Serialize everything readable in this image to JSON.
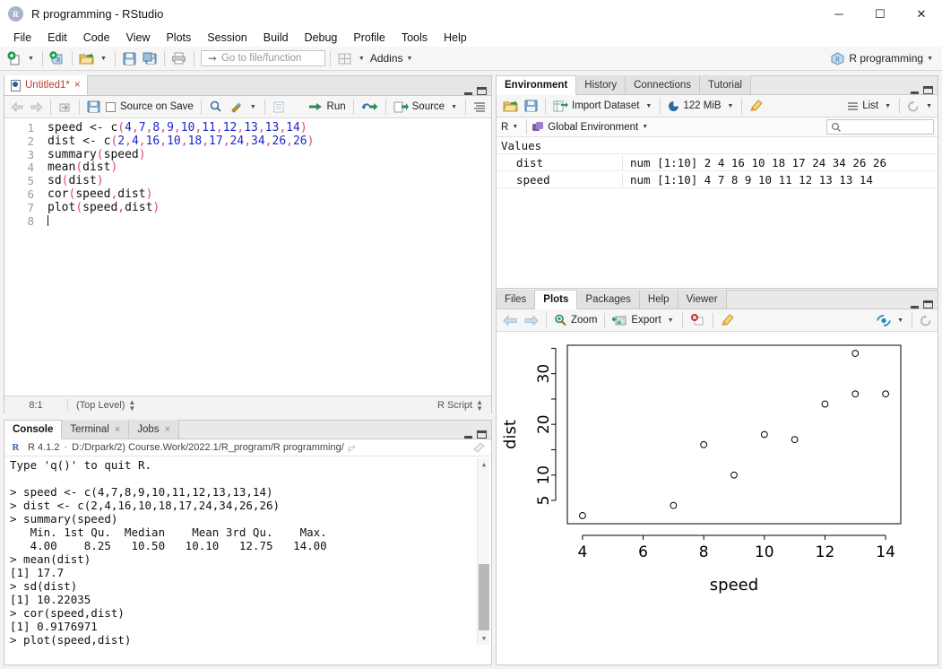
{
  "window": {
    "title": "R programming - RStudio",
    "app_icon": "R",
    "minimize": "─",
    "maximize": "☐",
    "close": "✕"
  },
  "menubar": {
    "items": [
      "File",
      "Edit",
      "Code",
      "View",
      "Plots",
      "Session",
      "Build",
      "Debug",
      "Profile",
      "Tools",
      "Help"
    ]
  },
  "toolbar": {
    "goto_placeholder": "Go to file/function",
    "addins_label": "Addins",
    "project_label": "R programming"
  },
  "source": {
    "tab_label": "Untitled1*",
    "tab_close": "×",
    "toolbar": {
      "source_on_save": "Source on Save",
      "run_label": "Run",
      "source_label": "Source"
    },
    "line_numbers": [
      "1",
      "2",
      "3",
      "4",
      "5",
      "6",
      "7",
      "8"
    ],
    "code": [
      {
        "name": "speed",
        "op": " <- ",
        "fn": "c",
        "args": "4,7,8,9,10,11,12,13,13,14"
      },
      {
        "name": "dist",
        "op": " <- ",
        "fn": "c",
        "args": "2,4,16,10,18,17,24,34,26,26"
      },
      {
        "name": "",
        "op": "",
        "fn": "summary",
        "args": "speed"
      },
      {
        "name": "",
        "op": "",
        "fn": "mean",
        "args": "dist"
      },
      {
        "name": "",
        "op": "",
        "fn": "sd",
        "args": "dist"
      },
      {
        "name": "",
        "op": "",
        "fn": "cor",
        "args": "speed,dist"
      },
      {
        "name": "",
        "op": "",
        "fn": "plot",
        "args": "speed,dist"
      }
    ],
    "status": {
      "position": "8:1",
      "scope": "(Top Level)",
      "file_type": "R Script"
    }
  },
  "console": {
    "tabs": [
      {
        "label": "Console",
        "closable": false,
        "active": true
      },
      {
        "label": "Terminal",
        "closable": true,
        "active": false
      },
      {
        "label": "Jobs",
        "closable": true,
        "active": false
      }
    ],
    "close_glyph": "×",
    "r_version": "R 4.1.2",
    "separator": "·",
    "working_dir": "D:/Drpark/2) Course.Work/2022.1/R_program/R programming/",
    "lines": [
      {
        "type": "out",
        "text": "Type 'q()' to quit R."
      },
      {
        "type": "out",
        "text": ""
      },
      {
        "type": "cmd",
        "text": "> speed <- c(4,7,8,9,10,11,12,13,13,14)"
      },
      {
        "type": "cmd",
        "text": "> dist <- c(2,4,16,10,18,17,24,34,26,26)"
      },
      {
        "type": "cmd",
        "text": "> summary(speed)"
      },
      {
        "type": "out",
        "text": "   Min. 1st Qu.  Median    Mean 3rd Qu.    Max. "
      },
      {
        "type": "out",
        "text": "   4.00    8.25   10.50   10.10   12.75   14.00 "
      },
      {
        "type": "cmd",
        "text": "> mean(dist)"
      },
      {
        "type": "out",
        "text": "[1] 17.7"
      },
      {
        "type": "cmd",
        "text": "> sd(dist)"
      },
      {
        "type": "out",
        "text": "[1] 10.22035"
      },
      {
        "type": "cmd",
        "text": "> cor(speed,dist)"
      },
      {
        "type": "out",
        "text": "[1] 0.9176971"
      },
      {
        "type": "cmd",
        "text": "> plot(speed,dist)"
      },
      {
        "type": "prompt",
        "text": "> "
      }
    ]
  },
  "environment": {
    "tabs": [
      {
        "label": "Environment",
        "active": true
      },
      {
        "label": "History",
        "active": false
      },
      {
        "label": "Connections",
        "active": false
      },
      {
        "label": "Tutorial",
        "active": false
      }
    ],
    "toolbar": {
      "import_dataset": "Import Dataset",
      "memory": "122 MiB",
      "view_mode": "List"
    },
    "scope": {
      "language": "R",
      "environment": "Global Environment"
    },
    "search_placeholder": "",
    "group_label": "Values",
    "rows": [
      {
        "name": "dist",
        "value": "num [1:10] 2 4 16 10 18 17 24 34 26 26"
      },
      {
        "name": "speed",
        "value": "num [1:10] 4 7 8 9 10 11 12 13 13 14"
      }
    ]
  },
  "plots": {
    "tabs": [
      {
        "label": "Files",
        "active": false
      },
      {
        "label": "Plots",
        "active": true
      },
      {
        "label": "Packages",
        "active": false
      },
      {
        "label": "Help",
        "active": false
      },
      {
        "label": "Viewer",
        "active": false
      }
    ],
    "toolbar": {
      "zoom_label": "Zoom",
      "export_label": "Export"
    }
  },
  "chart_data": {
    "type": "scatter",
    "title": "",
    "xlabel": "speed",
    "ylabel": "dist",
    "x": [
      4,
      7,
      8,
      9,
      10,
      11,
      12,
      13,
      13,
      14
    ],
    "y": [
      2,
      4,
      16,
      10,
      18,
      17,
      24,
      34,
      26,
      26
    ],
    "xlim": [
      3.5,
      14.5
    ],
    "ylim": [
      0.4,
      35.6
    ],
    "xticks": [
      4,
      6,
      8,
      10,
      12,
      14
    ],
    "xticklabels": [
      "4",
      "6",
      "8",
      "10",
      "12",
      "14"
    ],
    "yticks": [
      5,
      10,
      15,
      20,
      25,
      30,
      35
    ],
    "yticklabels": [
      "5",
      "10",
      "",
      "20",
      "",
      "30",
      ""
    ],
    "grid": false,
    "legend": null,
    "marker": "open-circle",
    "marker_color": "#000000"
  }
}
